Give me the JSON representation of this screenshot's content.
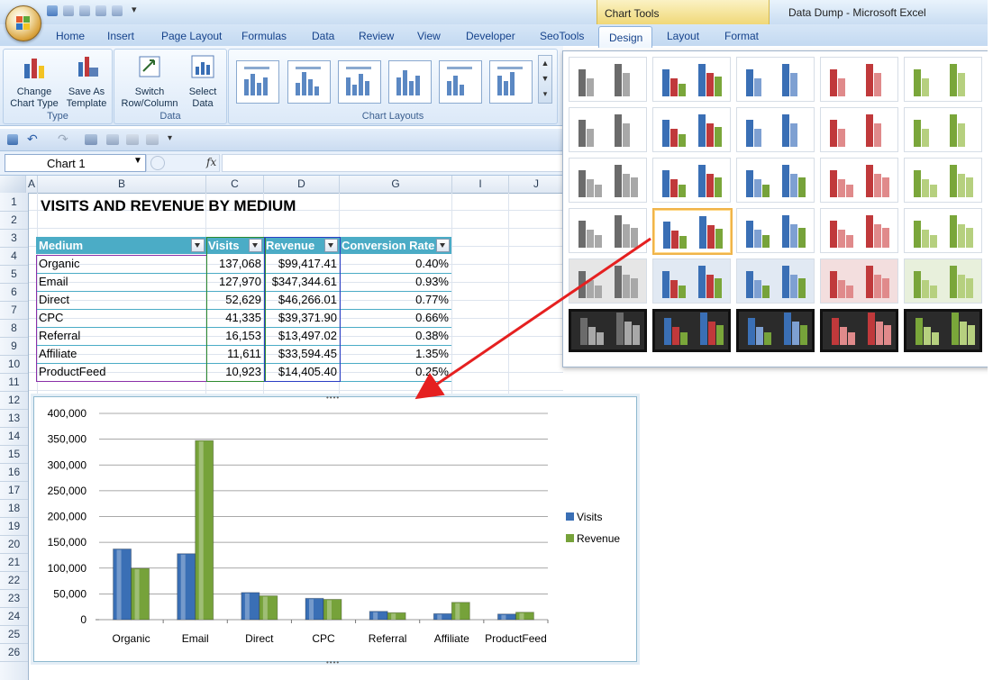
{
  "window": {
    "app_title": "Data Dump - Microsoft Excel",
    "context_tab_group": "Chart Tools"
  },
  "tabs": [
    {
      "label": "Home"
    },
    {
      "label": "Insert"
    },
    {
      "label": "Page Layout"
    },
    {
      "label": "Formulas"
    },
    {
      "label": "Data"
    },
    {
      "label": "Review"
    },
    {
      "label": "View"
    },
    {
      "label": "Developer"
    },
    {
      "label": "SeoTools"
    },
    {
      "label": "Design",
      "active": true
    },
    {
      "label": "Layout"
    },
    {
      "label": "Format"
    }
  ],
  "ribbon": {
    "type_group": {
      "label": "Type",
      "change_type_1": "Change",
      "change_type_2": "Chart Type",
      "save_template_1": "Save As",
      "save_template_2": "Template"
    },
    "data_group": {
      "label": "Data",
      "switch_1": "Switch",
      "switch_2": "Row/Column",
      "select_1": "Select",
      "select_2": "Data"
    },
    "layouts_group": {
      "label": "Chart Layouts"
    }
  },
  "formula_bar": {
    "name_box": "Chart 1",
    "fx": "fx",
    "formula": ""
  },
  "grid": {
    "columns": [
      "A",
      "B",
      "C",
      "D",
      "G",
      "I",
      "J"
    ],
    "rows": [
      "1",
      "2",
      "3",
      "4",
      "5",
      "6",
      "7",
      "8",
      "9",
      "10",
      "11",
      "12",
      "13",
      "14",
      "15",
      "16",
      "17",
      "18",
      "19",
      "20",
      "21",
      "22",
      "23",
      "24",
      "25",
      "26"
    ]
  },
  "sheet": {
    "title": "VISITS AND REVENUE BY MEDIUM",
    "headers": [
      "Medium",
      "Visits",
      "Revenue",
      "Conversion Rate"
    ],
    "rows": [
      [
        "Organic",
        "137,068",
        "$99,417.41",
        "0.40%"
      ],
      [
        "Email",
        "127,970",
        "$347,344.61",
        "0.93%"
      ],
      [
        "Direct",
        "52,629",
        "$46,266.01",
        "0.77%"
      ],
      [
        "CPC",
        "41,335",
        "$39,371.90",
        "0.66%"
      ],
      [
        "Referral",
        "16,153",
        "$13,497.02",
        "0.38%"
      ],
      [
        "Affiliate",
        "11,611",
        "$33,594.45",
        "1.35%"
      ],
      [
        "ProductFeed",
        "10,923",
        "$14,405.40",
        "0.25%"
      ]
    ]
  },
  "chart_data": {
    "type": "bar",
    "categories": [
      "Organic",
      "Email",
      "Direct",
      "CPC",
      "Referral",
      "Affiliate",
      "ProductFeed"
    ],
    "series": [
      {
        "name": "Visits",
        "values": [
          137068,
          127970,
          52629,
          41335,
          16153,
          11611,
          10923
        ],
        "color": "#3a6fb5"
      },
      {
        "name": "Revenue",
        "values": [
          99417.41,
          347344.61,
          46266.01,
          39371.9,
          13497.02,
          33594.45,
          14405.4
        ],
        "color": "#76a23a"
      }
    ],
    "yticks": [
      "400,000",
      "350,000",
      "300,000",
      "250,000",
      "200,000",
      "150,000",
      "100,000",
      "50,000",
      "0"
    ],
    "ylim": [
      0,
      400000
    ],
    "grid": true,
    "legend": "right",
    "title": "",
    "xlabel": "",
    "ylabel": ""
  },
  "gallery": {
    "selected_row": 3,
    "selected_col": 1,
    "rows": [
      [
        "#6b6b6b",
        "#3a6fb5",
        "#3a6fb5",
        "#c0393b",
        "#7aa63a"
      ],
      [
        "#6b6b6b",
        "#3a6fb5",
        "#3a6fb5",
        "#c0393b",
        "#7aa63a"
      ],
      [
        "#6b6b6b",
        "#3a6fb5",
        "#3a6fb5",
        "#c0393b",
        "#7aa63a"
      ],
      [
        "#6b6b6b",
        "#3a6fb5",
        "#3a6fb5",
        "#c0393b",
        "#7aa63a"
      ],
      [
        "#6b6b6b",
        "#3a6fb5",
        "#3a6fb5",
        "#c0393b",
        "#7aa63a"
      ],
      [
        "#6b6b6b",
        "#3a6fb5",
        "#3a6fb5",
        "#c0393b",
        "#7aa63a"
      ]
    ]
  },
  "colors": {
    "table_header": "#4bacc6",
    "ribbon_bg": "#dbe8f7",
    "arrow": "#e52020",
    "selection": "#f0b44a"
  }
}
